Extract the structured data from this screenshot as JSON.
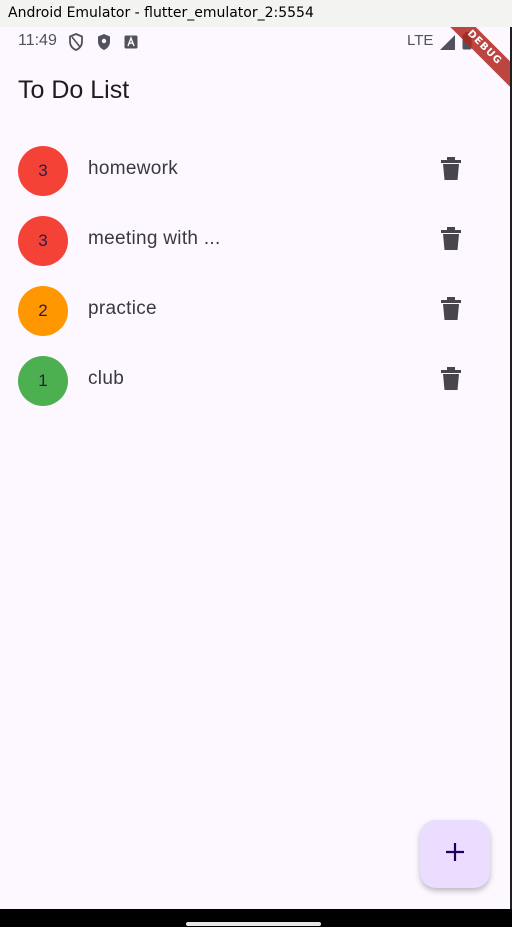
{
  "window": {
    "title": "Android Emulator - flutter_emulator_2:5554"
  },
  "status_bar": {
    "time": "11:49",
    "network": "LTE",
    "icons": [
      "shield-outline-icon",
      "shield-filled-icon",
      "text-a-icon",
      "signal-icon",
      "battery-icon"
    ]
  },
  "debug_banner": "DEBUG",
  "app": {
    "title": "To Do List"
  },
  "todos": [
    {
      "priority": "3",
      "title": "homework",
      "color": "#f44336"
    },
    {
      "priority": "3",
      "title": "meeting with ...",
      "color": "#f44336"
    },
    {
      "priority": "2",
      "title": "practice",
      "color": "#ff9800"
    },
    {
      "priority": "1",
      "title": "club",
      "color": "#4caf50"
    }
  ],
  "fab": {
    "icon": "plus-icon",
    "color": "#eaddff"
  },
  "colors": {
    "background": "#fdf7ff",
    "icon": "#49454f"
  }
}
